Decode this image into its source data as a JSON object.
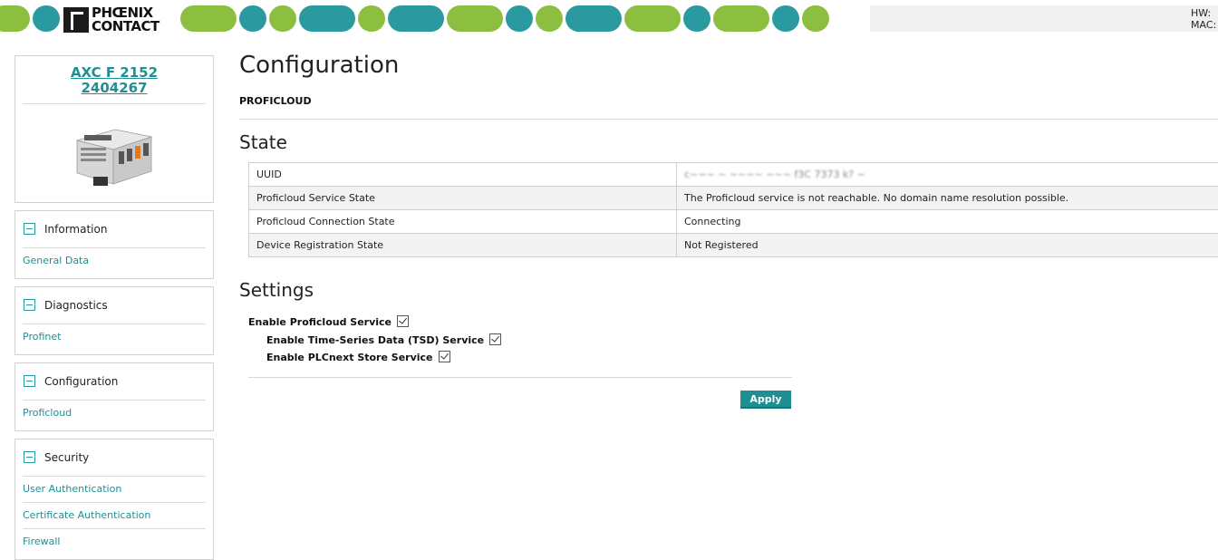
{
  "brand": {
    "logo_line1": "PHŒNIX",
    "logo_line2": "CONTACT",
    "green": "#8cbf3f",
    "teal": "#2a9aa0"
  },
  "header": {
    "hw_label": "HW:",
    "mac_label": "MAC:"
  },
  "device": {
    "name": "AXC F 2152",
    "article": "2404267"
  },
  "sidebar": {
    "sections": [
      {
        "title": "Information",
        "items": [
          "General Data"
        ]
      },
      {
        "title": "Diagnostics",
        "items": [
          "Profinet"
        ]
      },
      {
        "title": "Configuration",
        "items": [
          "Proficloud"
        ]
      },
      {
        "title": "Security",
        "items": [
          "User Authentication",
          "Certificate Authentication",
          "Firewall"
        ]
      }
    ]
  },
  "page": {
    "title": "Configuration",
    "subtitle": "PROFICLOUD"
  },
  "state": {
    "heading": "State",
    "rows": [
      {
        "label": "UUID",
        "value": "c~~~ ~ ~~~~ ~~~ f3C 7373 k? ~"
      },
      {
        "label": "Proficloud Service State",
        "value": "The Proficloud service is not reachable. No domain name resolution possible."
      },
      {
        "label": "Proficloud Connection State",
        "value": "Connecting"
      },
      {
        "label": "Device Registration State",
        "value": "Not Registered"
      }
    ]
  },
  "settings": {
    "heading": "Settings",
    "enable_proficloud": {
      "label": "Enable Proficloud Service",
      "checked": true
    },
    "enable_tsd": {
      "label": "Enable Time-Series Data (TSD) Service",
      "checked": true
    },
    "enable_store": {
      "label": "Enable PLCnext Store Service",
      "checked": true
    },
    "apply_label": "Apply"
  }
}
